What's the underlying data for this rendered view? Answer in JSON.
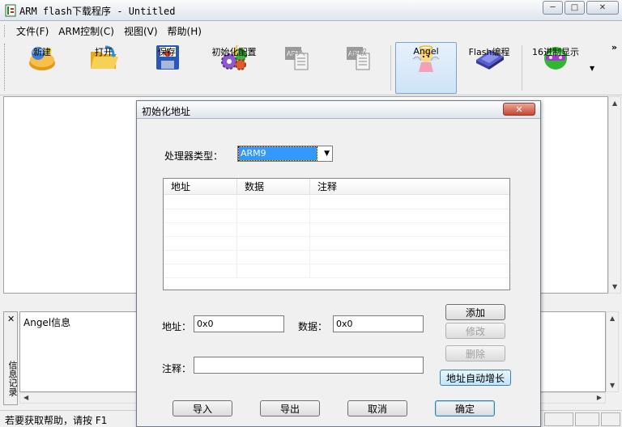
{
  "window": {
    "title": "ARM flash下载程序 - Untitled",
    "controls": [
      "─",
      "□",
      "✕"
    ]
  },
  "menu": [
    "文件(F)",
    "ARM控制(C)",
    "视图(V)",
    "帮助(H)"
  ],
  "toolbar": {
    "buttons": [
      {
        "label": "新建",
        "icon": "new-file-icon",
        "disabled": false
      },
      {
        "label": "打开",
        "icon": "open-folder-icon",
        "disabled": false
      },
      {
        "label": "保存",
        "icon": "save-disk-icon",
        "disabled": false
      },
      {
        "label": "初始化配置",
        "icon": "gears-icon",
        "disabled": false
      },
      {
        "label": "写入",
        "icon": "arm-write-icon",
        "disabled": true
      },
      {
        "label": "读取",
        "icon": "arm-read-icon",
        "disabled": true
      },
      {
        "label": "Angel",
        "icon": "angel-icon",
        "disabled": false,
        "active": true
      },
      {
        "label": "Flash编程",
        "icon": "flash-chip-icon",
        "disabled": false
      },
      {
        "label": "16进制显示",
        "icon": "hex-display-icon",
        "disabled": false
      }
    ],
    "overflow": "»"
  },
  "info_panel": {
    "close": "✕",
    "side_label": "信息记录",
    "text": "Angel信息"
  },
  "status": {
    "text": "若要获取帮助，请按 F1"
  },
  "dialog": {
    "title": "初始化地址",
    "close": "✕",
    "processor_label": "处理器类型：",
    "processor_value": "ARM9",
    "table": {
      "columns": [
        "地址",
        "数据",
        "注释"
      ],
      "rows": []
    },
    "address_label": "地址：",
    "address_value": "0x0",
    "data_label": "数据：",
    "data_value": "0x0",
    "comment_label": "注释：",
    "comment_value": "",
    "buttons": {
      "add": "添加",
      "modify": "修改",
      "delete": "删除",
      "auto_inc": "地址自动增长",
      "import": "导入",
      "export": "导出",
      "cancel": "取消",
      "ok": "确定"
    }
  },
  "colors": {
    "selection": "#3399ff",
    "dialog_close": "#c9452f"
  }
}
